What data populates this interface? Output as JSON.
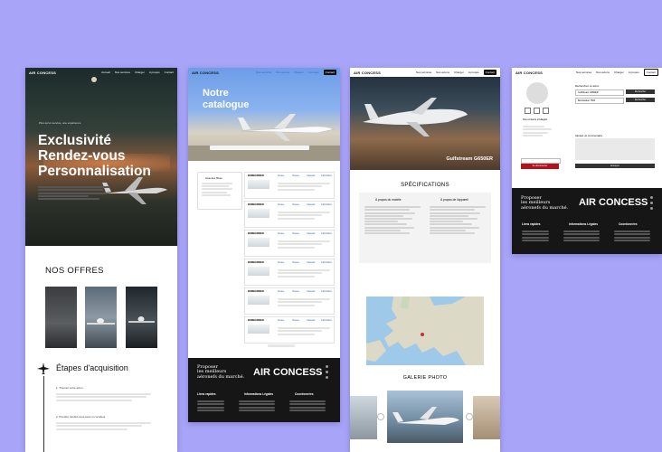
{
  "brand": "AIR CONCESS",
  "colors": {
    "background": "#a8a4f7",
    "accent_red": "#b3121b",
    "dark": "#161616",
    "link_blue": "#3a60c8"
  },
  "p1": {
    "nav": [
      "Accueil",
      "Nos services",
      "Charger",
      "A propos",
      "Contact"
    ],
    "hero_kicker": "Plus qu'un service, une expérience",
    "hero_title": [
      "Exclusivité",
      "Rendez-vous",
      "Personnalisation"
    ],
    "offers_title": "NOS OFFRES",
    "steps_title": "Étapes d'acquisition",
    "step1": "1. Trouvez votre avion",
    "step2": "2. Prendre rendez-vous avec un vendeur"
  },
  "p2": {
    "nav": [
      "Nos services",
      "Nos avions",
      "Charger",
      "A propos",
      "Contact"
    ],
    "hero_title": [
      "Notre",
      "catalogue"
    ],
    "filter_label": "Liste des filtres",
    "listings": [
      {
        "model": "BOMBARDIER",
        "cols": [
          "Portée",
          "Vitesse",
          "Capacité",
          "Fabrication"
        ]
      },
      {
        "model": "BOMBARDIER",
        "cols": [
          "Portée",
          "Vitesse",
          "Capacité",
          "Fabrication"
        ]
      },
      {
        "model": "BOMBARDIER",
        "cols": [
          "Portée",
          "Vitesse",
          "Capacité",
          "Fabrication"
        ]
      },
      {
        "model": "BOMBARDIER",
        "cols": [
          "Portée",
          "Vitesse",
          "Capacité",
          "Fabrication"
        ]
      },
      {
        "model": "BOMBARDIER",
        "cols": [
          "Portée",
          "Vitesse",
          "Capacité",
          "Fabrication"
        ]
      },
      {
        "model": "BOMBARDIER",
        "cols": [
          "Portée",
          "Vitesse",
          "Capacité",
          "Fabrication"
        ]
      }
    ],
    "footer": {
      "tagline": [
        "Proposer",
        "les meilleurs",
        "aéronefs du marché."
      ],
      "col1_title": "Liens rapides",
      "col2_title": "Informations Légales",
      "col3_title": "Coordonnées"
    }
  },
  "p3": {
    "nav": [
      "Nos services",
      "Nos avions",
      "Charger",
      "A propos",
      "Contact"
    ],
    "hero_caption": "Gulfstream G650ER",
    "spec_title": "SPÉCIFICATIONS",
    "spec_left_title": "À propos du modèle",
    "spec_right_title": "À propos de l'appareil",
    "gallery_title": "GALERIE PHOTO"
  },
  "p4": {
    "nav": [
      "Nos services",
      "Nos avions",
      "Charger",
      "A propos",
      "Contact"
    ],
    "contact_header": "Nos contacts privilégiés",
    "search_label": "Recherchez un avion",
    "search_value_1": "Gulfstream G650ER",
    "search_value_2": "Bombardier 7500",
    "search_btn": "Rechercher",
    "message_label": "Ajoutez un commentaire",
    "send_btn": "Envoyer",
    "red_btn": "Se déconnecter",
    "footer": {
      "tagline": [
        "Proposer",
        "les meilleurs",
        "aéronefs du marché."
      ],
      "col1_title": "Liens rapides",
      "col2_title": "Informations Légales",
      "col3_title": "Coordonnées"
    }
  }
}
